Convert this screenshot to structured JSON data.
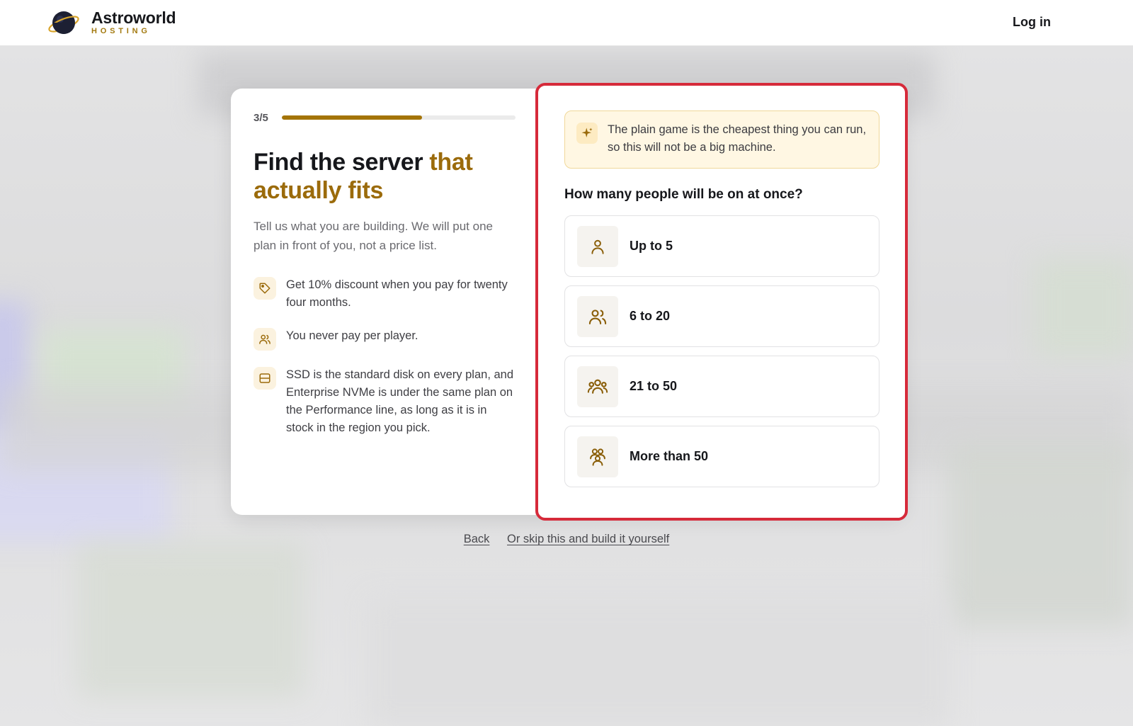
{
  "header": {
    "brand_name": "Astroworld",
    "brand_sub": "HOSTING",
    "login_label": "Log in"
  },
  "wizard": {
    "step_label": "3/5",
    "progress_fraction": 0.6,
    "headline_main": "Find the server ",
    "headline_accent": "that actually fits",
    "subtext": "Tell us what you are building. We will put one plan in front of you, not a price list.",
    "perks": [
      {
        "icon": "tag-icon",
        "text": "Get 10% discount when you pay for twenty four months."
      },
      {
        "icon": "users-icon",
        "text": "You never pay per player."
      },
      {
        "icon": "storage-icon",
        "text": "SSD is the standard disk on every plan, and Enterprise NVMe is under the same plan on the Performance line, as long as it is in stock in the region you pick."
      }
    ],
    "tip": {
      "icon": "sparkle-icon",
      "text": "The plain game is the cheapest thing you can run, so this will not be a big machine."
    },
    "question": "How many people will be on at once?",
    "options": [
      {
        "icon": "single-user-icon",
        "label": "Up to 5"
      },
      {
        "icon": "two-users-icon",
        "label": "6 to 20"
      },
      {
        "icon": "three-users-icon",
        "label": "21 to 50"
      },
      {
        "icon": "group-users-icon",
        "label": "More than 50"
      }
    ]
  },
  "footer_links": {
    "back_label": "Back",
    "skip_label": "Or skip this and build it yourself"
  },
  "colors": {
    "accent": "#9b6b0b",
    "progress": "#a47407",
    "highlight_border": "#d62a3a",
    "tip_background": "#fff7e3"
  }
}
